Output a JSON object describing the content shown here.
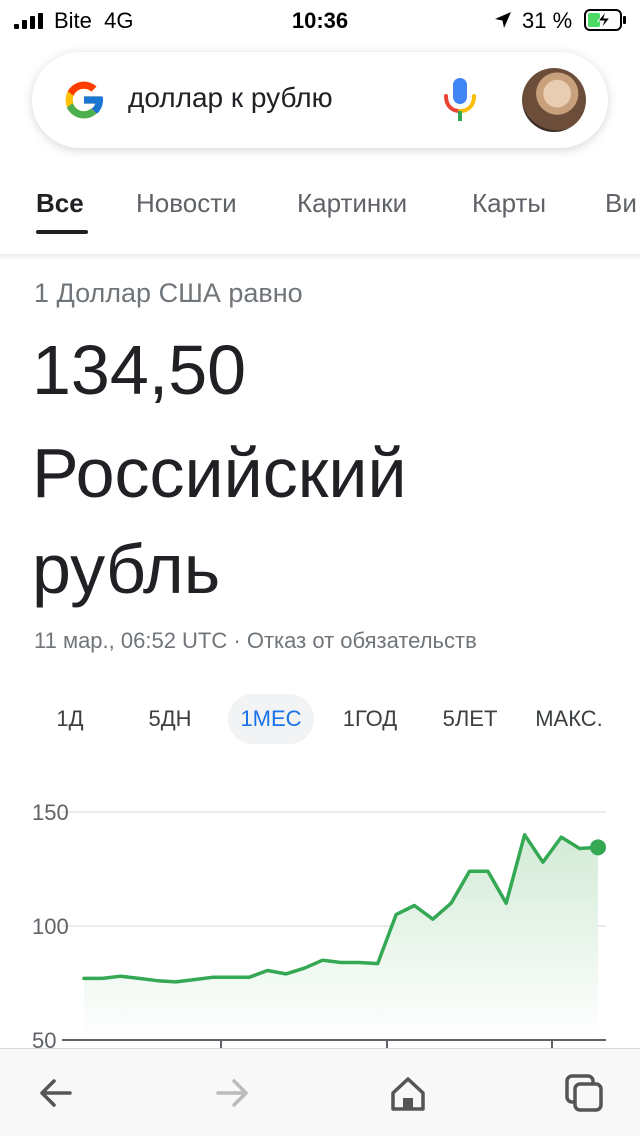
{
  "status_bar": {
    "carrier": "Bite",
    "network": "4G",
    "time": "10:36",
    "battery_percent": "31 %"
  },
  "search": {
    "query": "доллар к рублю"
  },
  "tabs": [
    {
      "label": "Все",
      "active": true
    },
    {
      "label": "Новости"
    },
    {
      "label": "Картинки"
    },
    {
      "label": "Карты"
    },
    {
      "label": "Ви"
    }
  ],
  "result": {
    "equals_text": "1 Доллар США равно",
    "value": "134,50",
    "currency_name": "Российский рубль",
    "timestamp": "11 мар., 06:52 UTC",
    "separator": " · ",
    "disclaimer": "Отказ от обязательств"
  },
  "ranges": [
    {
      "label": "1Д"
    },
    {
      "label": "5ДН"
    },
    {
      "label": "1МЕС",
      "active": true
    },
    {
      "label": "1ГОД"
    },
    {
      "label": "5ЛЕТ"
    },
    {
      "label": "МАКС."
    }
  ],
  "chart_data": {
    "type": "area",
    "ylim": [
      50,
      150
    ],
    "ytick_labels": [
      "150",
      "100",
      "50"
    ],
    "yticks": [
      150,
      100,
      50
    ],
    "series": [
      {
        "values": [
          77,
          77,
          78,
          77,
          76,
          75.5,
          76.5,
          77.5,
          77.5,
          77.5,
          80.5,
          79,
          81.5,
          85,
          84,
          84,
          83.5,
          105,
          109,
          103,
          110,
          124,
          124,
          110,
          140,
          128,
          139,
          134,
          134.5
        ]
      }
    ],
    "colors": {
      "line": "#34a853",
      "fill_top": "#d3ebd7",
      "grid": "#e6e6e6",
      "axis": "#5f6368"
    }
  }
}
